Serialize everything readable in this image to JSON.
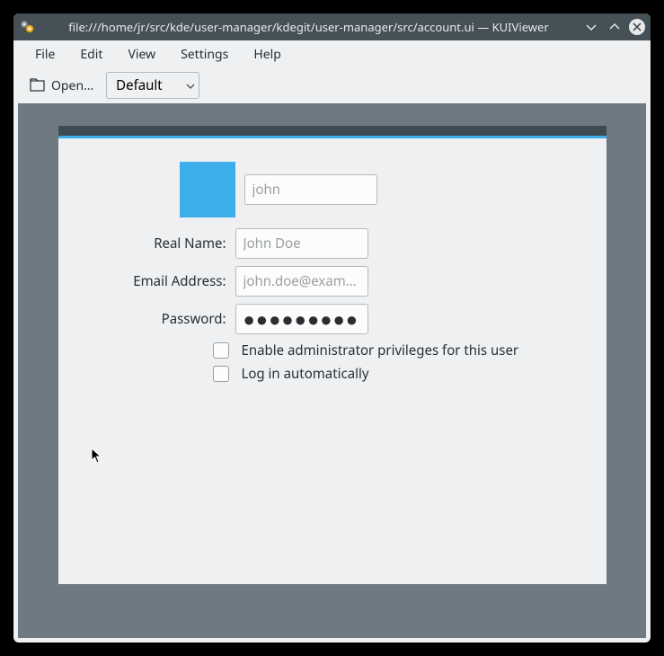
{
  "window": {
    "title": "file:///home/jr/src/kde/user-manager/kdegit/user-manager/src/account.ui — KUIViewer"
  },
  "menubar": {
    "file": "File",
    "edit": "Edit",
    "view": "View",
    "settings": "Settings",
    "help": "Help"
  },
  "toolbar": {
    "open_label": "Open…",
    "style_selected": "Default"
  },
  "form": {
    "username_placeholder": "john",
    "realname_label": "Real Name:",
    "realname_placeholder": "John Doe",
    "email_label": "Email Address:",
    "email_placeholder": "john.doe@exam…",
    "password_label": "Password:",
    "password_mask": "●●●●●●●●●",
    "admin_label": "Enable administrator privileges for this user",
    "autologin_label": "Log in automatically"
  }
}
